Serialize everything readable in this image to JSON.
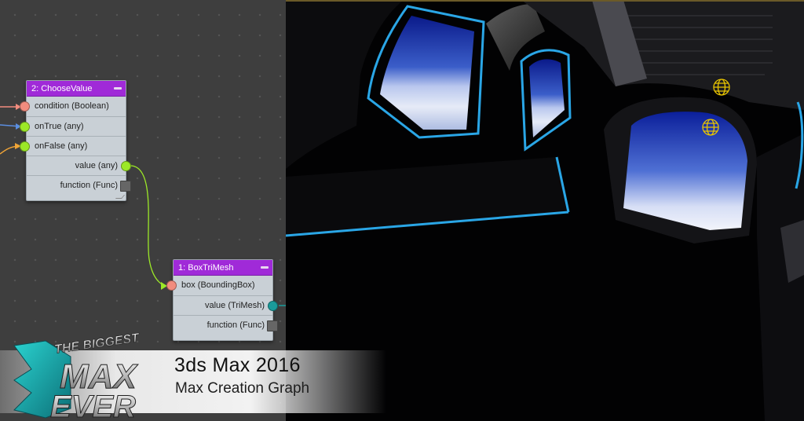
{
  "graph": {
    "nodes": [
      {
        "title": "2: ChooseValue",
        "inputs": [
          {
            "label": "condition (Boolean)",
            "pin_color": "#f28c7e"
          },
          {
            "label": "onTrue (any)",
            "pin_color": "#9ce827"
          },
          {
            "label": "onFalse (any)",
            "pin_color": "#9ce827"
          }
        ],
        "outputs": [
          {
            "label": "value (any)",
            "pin_color": "#9ce827"
          },
          {
            "label": "function (Func)",
            "pin_color": "#666666"
          }
        ]
      },
      {
        "title": "1: BoxTriMesh",
        "inputs": [
          {
            "label": "box (BoundingBox)",
            "pin_color": "#f28c7e"
          }
        ],
        "outputs": [
          {
            "label": "value (TriMesh)",
            "pin_color": "#1a9b9b"
          },
          {
            "label": "function (Func)",
            "pin_color": "#666666"
          }
        ]
      }
    ],
    "colors": {
      "node_header": "#a02ad8",
      "wire_condition": "#f28c7e",
      "wire_ontrue": "#5b8ee0",
      "wire_onfalse": "#f0a437",
      "wire_value": "#9ce827"
    }
  },
  "banner": {
    "logo_text_line1": "THE BIGGEST",
    "logo_text_line2": "MAX",
    "logo_text_line3": "EVER",
    "title": "3ds Max 2016",
    "subtitle": "Max Creation Graph"
  }
}
